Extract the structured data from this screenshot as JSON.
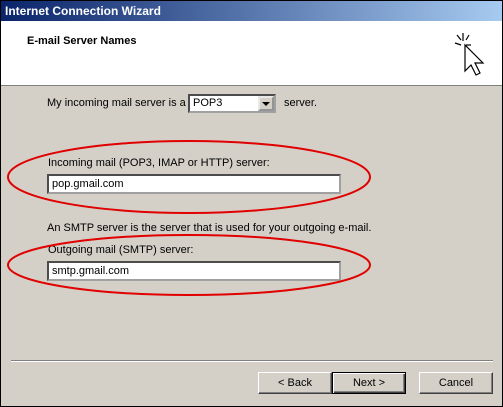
{
  "window": {
    "title": "Internet Connection Wizard"
  },
  "header": {
    "title": "E-mail Server Names",
    "icon": "wizard-sparkle-cursor-icon"
  },
  "incoming_type": {
    "prefix": "My incoming mail server is a",
    "selected": "POP3",
    "suffix": "server."
  },
  "incoming_server": {
    "label": "Incoming mail (POP3, IMAP or HTTP) server:",
    "value": "pop.gmail.com"
  },
  "smtp_note": "An SMTP server is the server that is used for your outgoing e-mail.",
  "outgoing_server": {
    "label": "Outgoing mail (SMTP) server:",
    "value": "smtp.gmail.com"
  },
  "buttons": {
    "back": "< Back",
    "next": "Next >",
    "cancel": "Cancel"
  },
  "annotation_color": "#e00000"
}
